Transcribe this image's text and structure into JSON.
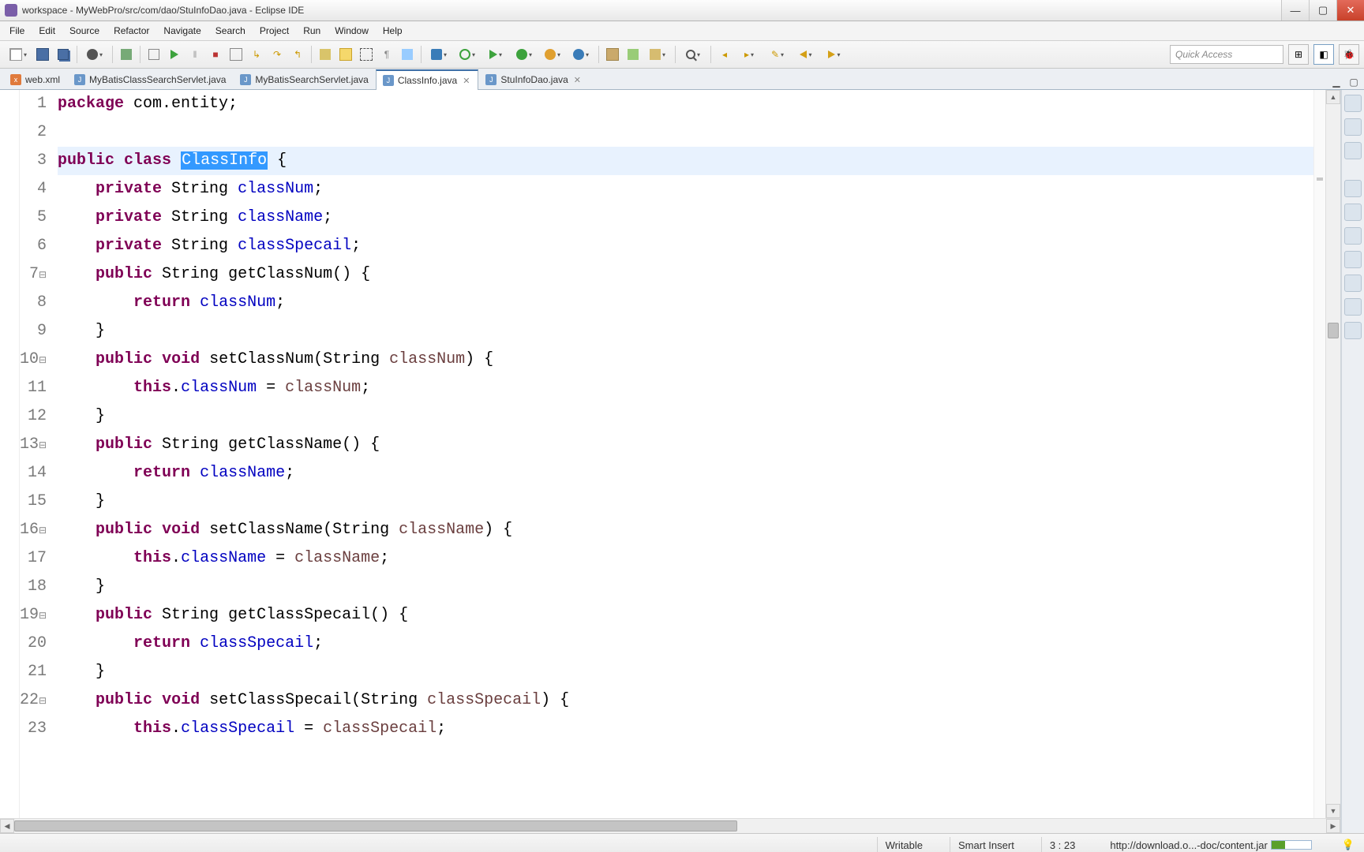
{
  "window": {
    "title": "workspace - MyWebPro/src/com/dao/StuInfoDao.java - Eclipse IDE"
  },
  "menu": [
    "File",
    "Edit",
    "Source",
    "Refactor",
    "Navigate",
    "Search",
    "Project",
    "Run",
    "Window",
    "Help"
  ],
  "quick_access_placeholder": "Quick Access",
  "tabs": [
    {
      "label": "web.xml",
      "icon": "x"
    },
    {
      "label": "MyBatisClassSearchServlet.java",
      "icon": "J"
    },
    {
      "label": "MyBatisSearchServlet.java",
      "icon": "J"
    },
    {
      "label": "ClassInfo.java",
      "icon": "J",
      "active": true,
      "closeable": true
    },
    {
      "label": "StuInfoDao.java",
      "icon": "J",
      "closeable": true
    }
  ],
  "cursor_hint_at": "StuInfoDao.java",
  "editor": {
    "selected_token_line": 3,
    "selected_token": "ClassInfo",
    "lines": [
      {
        "n": 1,
        "tokens": [
          [
            "kw",
            "package"
          ],
          [
            "",
            " com.entity;"
          ]
        ]
      },
      {
        "n": 2,
        "tokens": [
          [
            "",
            ""
          ]
        ]
      },
      {
        "n": 3,
        "tokens": [
          [
            "kw",
            "public"
          ],
          [
            "",
            " "
          ],
          [
            "kw",
            "class"
          ],
          [
            "",
            " "
          ],
          [
            "selclass",
            "ClassInfo"
          ],
          [
            "",
            " {"
          ]
        ],
        "hl": true
      },
      {
        "n": 4,
        "tokens": [
          [
            "",
            "    "
          ],
          [
            "kw",
            "private"
          ],
          [
            "",
            " String "
          ],
          [
            "field",
            "classNum"
          ],
          [
            "",
            ";"
          ]
        ]
      },
      {
        "n": 5,
        "tokens": [
          [
            "",
            "    "
          ],
          [
            "kw",
            "private"
          ],
          [
            "",
            " String "
          ],
          [
            "field",
            "className"
          ],
          [
            "",
            ";"
          ]
        ]
      },
      {
        "n": 6,
        "tokens": [
          [
            "",
            "    "
          ],
          [
            "kw",
            "private"
          ],
          [
            "",
            " String "
          ],
          [
            "field",
            "classSpecail"
          ],
          [
            "",
            ";"
          ]
        ]
      },
      {
        "n": 7,
        "tokens": [
          [
            "",
            "    "
          ],
          [
            "kw",
            "public"
          ],
          [
            "",
            " String getClassNum() {"
          ]
        ],
        "fold": true
      },
      {
        "n": 8,
        "tokens": [
          [
            "",
            "        "
          ],
          [
            "kw",
            "return"
          ],
          [
            "",
            " "
          ],
          [
            "field",
            "classNum"
          ],
          [
            "",
            ";"
          ]
        ]
      },
      {
        "n": 9,
        "tokens": [
          [
            "",
            "    }"
          ]
        ]
      },
      {
        "n": 10,
        "tokens": [
          [
            "",
            "    "
          ],
          [
            "kw",
            "public"
          ],
          [
            "",
            " "
          ],
          [
            "kw",
            "void"
          ],
          [
            "",
            " setClassNum(String "
          ],
          [
            "param",
            "classNum"
          ],
          [
            "",
            ") {"
          ]
        ],
        "fold": true
      },
      {
        "n": 11,
        "tokens": [
          [
            "",
            "        "
          ],
          [
            "kw",
            "this"
          ],
          [
            "",
            "."
          ],
          [
            "field",
            "classNum"
          ],
          [
            "",
            " = "
          ],
          [
            "param",
            "classNum"
          ],
          [
            "",
            ";"
          ]
        ]
      },
      {
        "n": 12,
        "tokens": [
          [
            "",
            "    }"
          ]
        ]
      },
      {
        "n": 13,
        "tokens": [
          [
            "",
            "    "
          ],
          [
            "kw",
            "public"
          ],
          [
            "",
            " String getClassName() {"
          ]
        ],
        "fold": true
      },
      {
        "n": 14,
        "tokens": [
          [
            "",
            "        "
          ],
          [
            "kw",
            "return"
          ],
          [
            "",
            " "
          ],
          [
            "field",
            "className"
          ],
          [
            "",
            ";"
          ]
        ]
      },
      {
        "n": 15,
        "tokens": [
          [
            "",
            "    }"
          ]
        ]
      },
      {
        "n": 16,
        "tokens": [
          [
            "",
            "    "
          ],
          [
            "kw",
            "public"
          ],
          [
            "",
            " "
          ],
          [
            "kw",
            "void"
          ],
          [
            "",
            " setClassName(String "
          ],
          [
            "param",
            "className"
          ],
          [
            "",
            ") {"
          ]
        ],
        "fold": true
      },
      {
        "n": 17,
        "tokens": [
          [
            "",
            "        "
          ],
          [
            "kw",
            "this"
          ],
          [
            "",
            "."
          ],
          [
            "field",
            "className"
          ],
          [
            "",
            " = "
          ],
          [
            "param",
            "className"
          ],
          [
            "",
            ";"
          ]
        ]
      },
      {
        "n": 18,
        "tokens": [
          [
            "",
            "    }"
          ]
        ]
      },
      {
        "n": 19,
        "tokens": [
          [
            "",
            "    "
          ],
          [
            "kw",
            "public"
          ],
          [
            "",
            " String getClassSpecail() {"
          ]
        ],
        "fold": true
      },
      {
        "n": 20,
        "tokens": [
          [
            "",
            "        "
          ],
          [
            "kw",
            "return"
          ],
          [
            "",
            " "
          ],
          [
            "field",
            "classSpecail"
          ],
          [
            "",
            ";"
          ]
        ]
      },
      {
        "n": 21,
        "tokens": [
          [
            "",
            "    }"
          ]
        ]
      },
      {
        "n": 22,
        "tokens": [
          [
            "",
            "    "
          ],
          [
            "kw",
            "public"
          ],
          [
            "",
            " "
          ],
          [
            "kw",
            "void"
          ],
          [
            "",
            " setClassSpecail(String "
          ],
          [
            "param",
            "classSpecail"
          ],
          [
            "",
            ") {"
          ]
        ],
        "fold": true
      },
      {
        "n": 23,
        "tokens": [
          [
            "",
            "        "
          ],
          [
            "kw",
            "this"
          ],
          [
            "",
            "."
          ],
          [
            "field",
            "classSpecail"
          ],
          [
            "",
            " = "
          ],
          [
            "param",
            "classSpecail"
          ],
          [
            "",
            ";"
          ]
        ]
      }
    ]
  },
  "status": {
    "writable": "Writable",
    "insert": "Smart Insert",
    "pos": "3 : 23",
    "download": "http://download.o...-doc/content.jar"
  }
}
